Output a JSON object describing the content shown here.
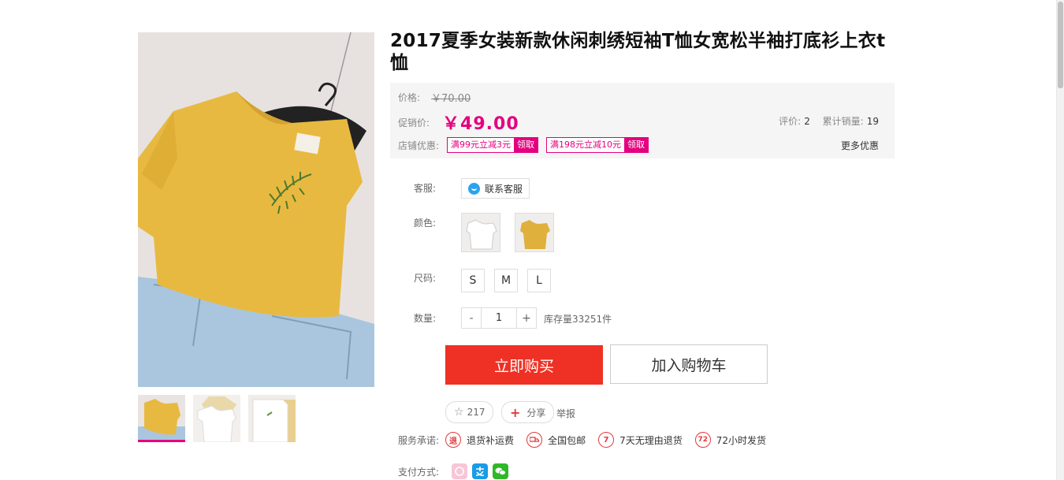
{
  "product": {
    "title": "2017夏季女装新款休闲刺绣短袖T恤女宽松半袖打底衫上衣t恤"
  },
  "price": {
    "original_label": "价格:",
    "original_value": "￥70.00",
    "promo_label": "促销价:",
    "promo_value": "￥49.00",
    "rating_label": "评价:",
    "rating_value": "2",
    "sales_label": "累计销量:",
    "sales_value": "19",
    "shop_offer_label": "店铺优惠:",
    "coupons": [
      {
        "text": "满99元立减3元",
        "btn": "领取"
      },
      {
        "text": "满198元立减10元",
        "btn": "领取"
      }
    ],
    "more_offers": "更多优惠"
  },
  "options": {
    "service_label": "客服:",
    "service_button": "联系客服",
    "color_label": "颜色:",
    "size_label": "尺码:",
    "sizes": [
      "S",
      "M",
      "L"
    ],
    "qty_label": "数量:",
    "qty_minus": "-",
    "qty_value": "1",
    "qty_plus": "+",
    "stock": "库存量33251件"
  },
  "actions": {
    "buy_now": "立即购买",
    "add_to_cart": "加入购物车",
    "like_count": "217",
    "share": "分享",
    "report": "举报"
  },
  "services": {
    "label": "服务承诺:",
    "items": [
      {
        "badge": "退",
        "text": "退货补运费"
      },
      {
        "badge": "",
        "text": "全国包邮"
      },
      {
        "badge": "7",
        "text": "7天无理由退货"
      },
      {
        "badge": "72",
        "text": "72小时发货"
      }
    ]
  },
  "payment": {
    "label": "支付方式:",
    "methods": [
      "credit-card-icon",
      "alipay-icon",
      "wechat-pay-icon"
    ]
  },
  "colors": {
    "accent_pink": "#e4007f",
    "buy_red": "#ee3124",
    "shirt_yellow": "#e8b941"
  }
}
